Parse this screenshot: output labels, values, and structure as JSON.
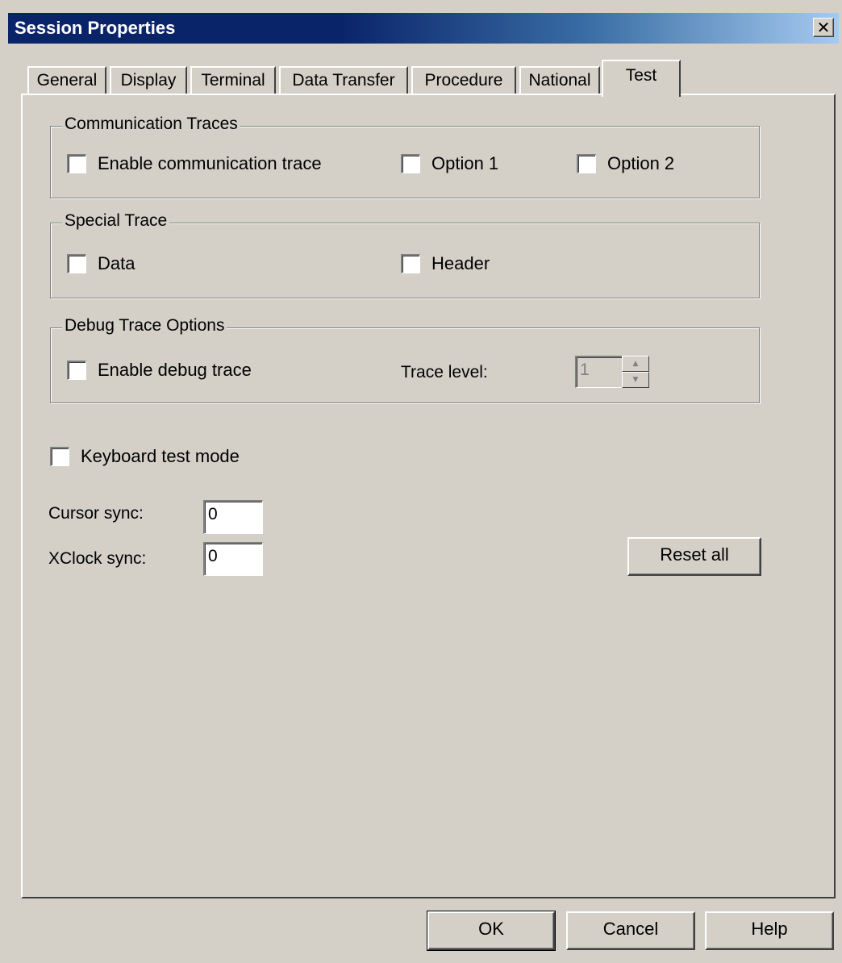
{
  "window": {
    "title": "Session Properties",
    "close_glyph": "✕"
  },
  "tabs": [
    {
      "label": "General"
    },
    {
      "label": "Display"
    },
    {
      "label": "Terminal"
    },
    {
      "label": "Data Transfer"
    },
    {
      "label": "Procedure"
    },
    {
      "label": "National"
    },
    {
      "label": "Test",
      "active": true
    }
  ],
  "communication_traces": {
    "legend": "Communication Traces",
    "enable_label": "Enable communication trace",
    "option1_label": "Option 1",
    "option2_label": "Option 2",
    "enable_checked": false,
    "option1_checked": false,
    "option2_checked": false
  },
  "special_trace": {
    "legend": "Special Trace",
    "data_label": "Data",
    "header_label": "Header",
    "data_checked": false,
    "header_checked": false
  },
  "debug_trace": {
    "legend": "Debug Trace Options",
    "enable_label": "Enable debug trace",
    "enable_checked": false,
    "trace_level_label": "Trace level:",
    "trace_level_value": "1",
    "trace_level_disabled": true
  },
  "keyboard_test_mode": {
    "label": "Keyboard test mode",
    "checked": false
  },
  "cursor_sync": {
    "label": "Cursor sync:",
    "value": "0"
  },
  "xclock_sync": {
    "label": "XClock sync:",
    "value": "0"
  },
  "buttons": {
    "reset_all": "Reset all",
    "ok": "OK",
    "cancel": "Cancel",
    "help": "Help"
  },
  "colors": {
    "title_bar": "#0a246a",
    "face": "#d4d0c8"
  }
}
